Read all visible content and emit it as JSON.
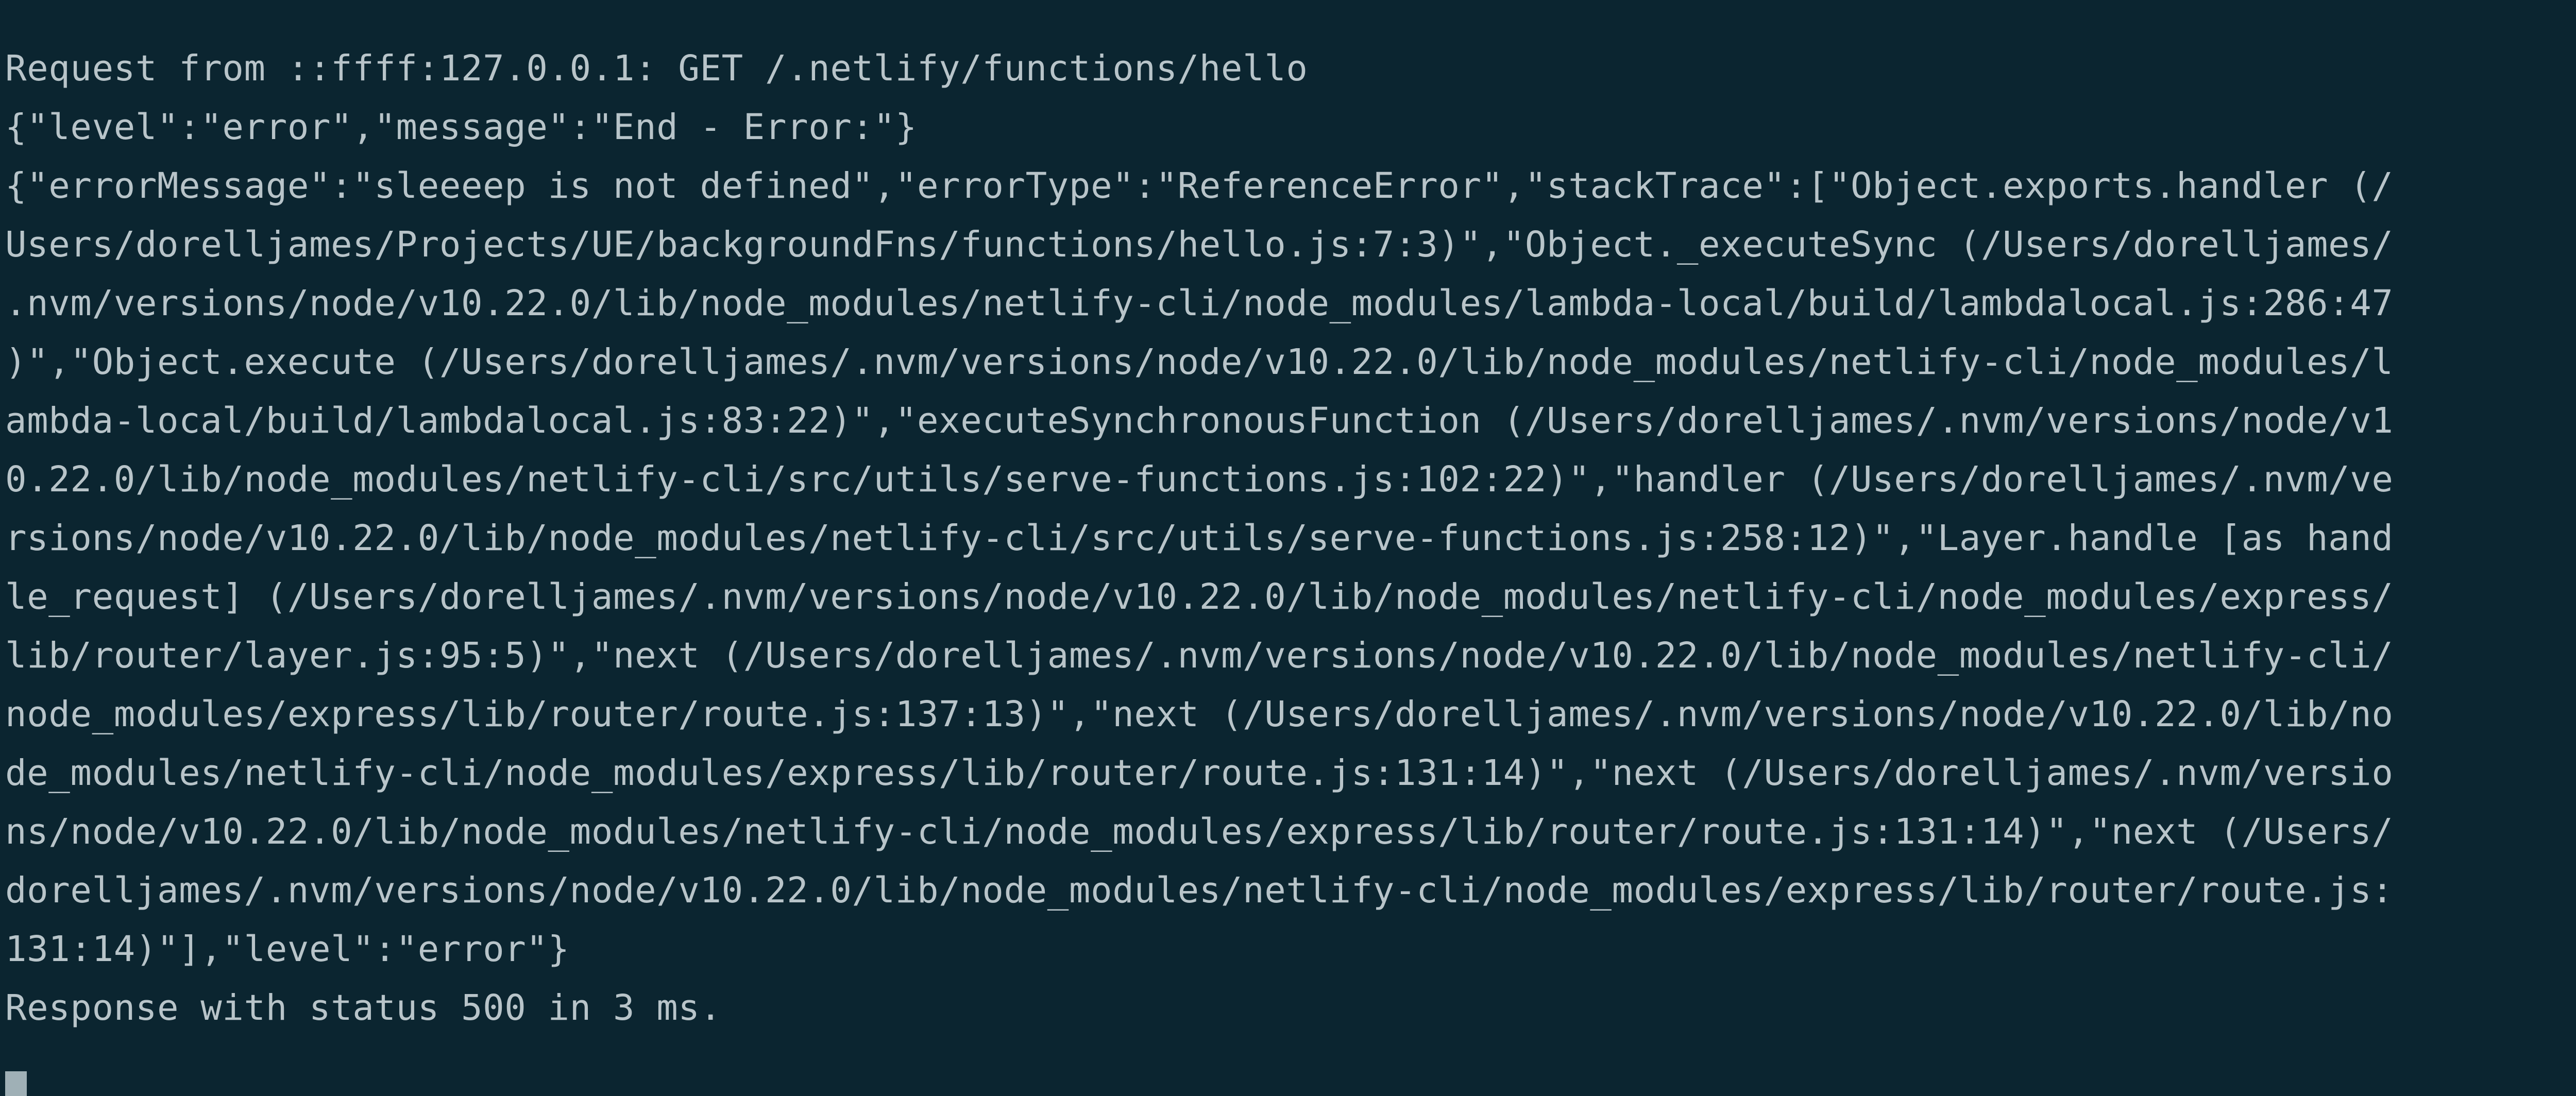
{
  "terminal": {
    "lines": [
      "Request from ::ffff:127.0.0.1: GET /.netlify/functions/hello",
      "{\"level\":\"error\",\"message\":\"End - Error:\"}",
      "{\"errorMessage\":\"sleeeep is not defined\",\"errorType\":\"ReferenceError\",\"stackTrace\":[\"Object.exports.handler (/",
      "Users/dorelljames/Projects/UE/backgroundFns/functions/hello.js:7:3)\",\"Object._executeSync (/Users/dorelljames/",
      ".nvm/versions/node/v10.22.0/lib/node_modules/netlify-cli/node_modules/lambda-local/build/lambdalocal.js:286:47",
      ")\",\"Object.execute (/Users/dorelljames/.nvm/versions/node/v10.22.0/lib/node_modules/netlify-cli/node_modules/l",
      "ambda-local/build/lambdalocal.js:83:22)\",\"executeSynchronousFunction (/Users/dorelljames/.nvm/versions/node/v1",
      "0.22.0/lib/node_modules/netlify-cli/src/utils/serve-functions.js:102:22)\",\"handler (/Users/dorelljames/.nvm/ve",
      "rsions/node/v10.22.0/lib/node_modules/netlify-cli/src/utils/serve-functions.js:258:12)\",\"Layer.handle [as hand",
      "le_request] (/Users/dorelljames/.nvm/versions/node/v10.22.0/lib/node_modules/netlify-cli/node_modules/express/",
      "lib/router/layer.js:95:5)\",\"next (/Users/dorelljames/.nvm/versions/node/v10.22.0/lib/node_modules/netlify-cli/",
      "node_modules/express/lib/router/route.js:137:13)\",\"next (/Users/dorelljames/.nvm/versions/node/v10.22.0/lib/no",
      "de_modules/netlify-cli/node_modules/express/lib/router/route.js:131:14)\",\"next (/Users/dorelljames/.nvm/versio",
      "ns/node/v10.22.0/lib/node_modules/netlify-cli/node_modules/express/lib/router/route.js:131:14)\",\"next (/Users/",
      "dorelljames/.nvm/versions/node/v10.22.0/lib/node_modules/netlify-cli/node_modules/express/lib/router/route.js:",
      "131:14)\"],\"level\":\"error\"}",
      "Response with status 500 in 3 ms."
    ]
  },
  "colors": {
    "background": "#0b2530",
    "text": "#b8c4c9",
    "cursor": "#9fb0b6"
  }
}
